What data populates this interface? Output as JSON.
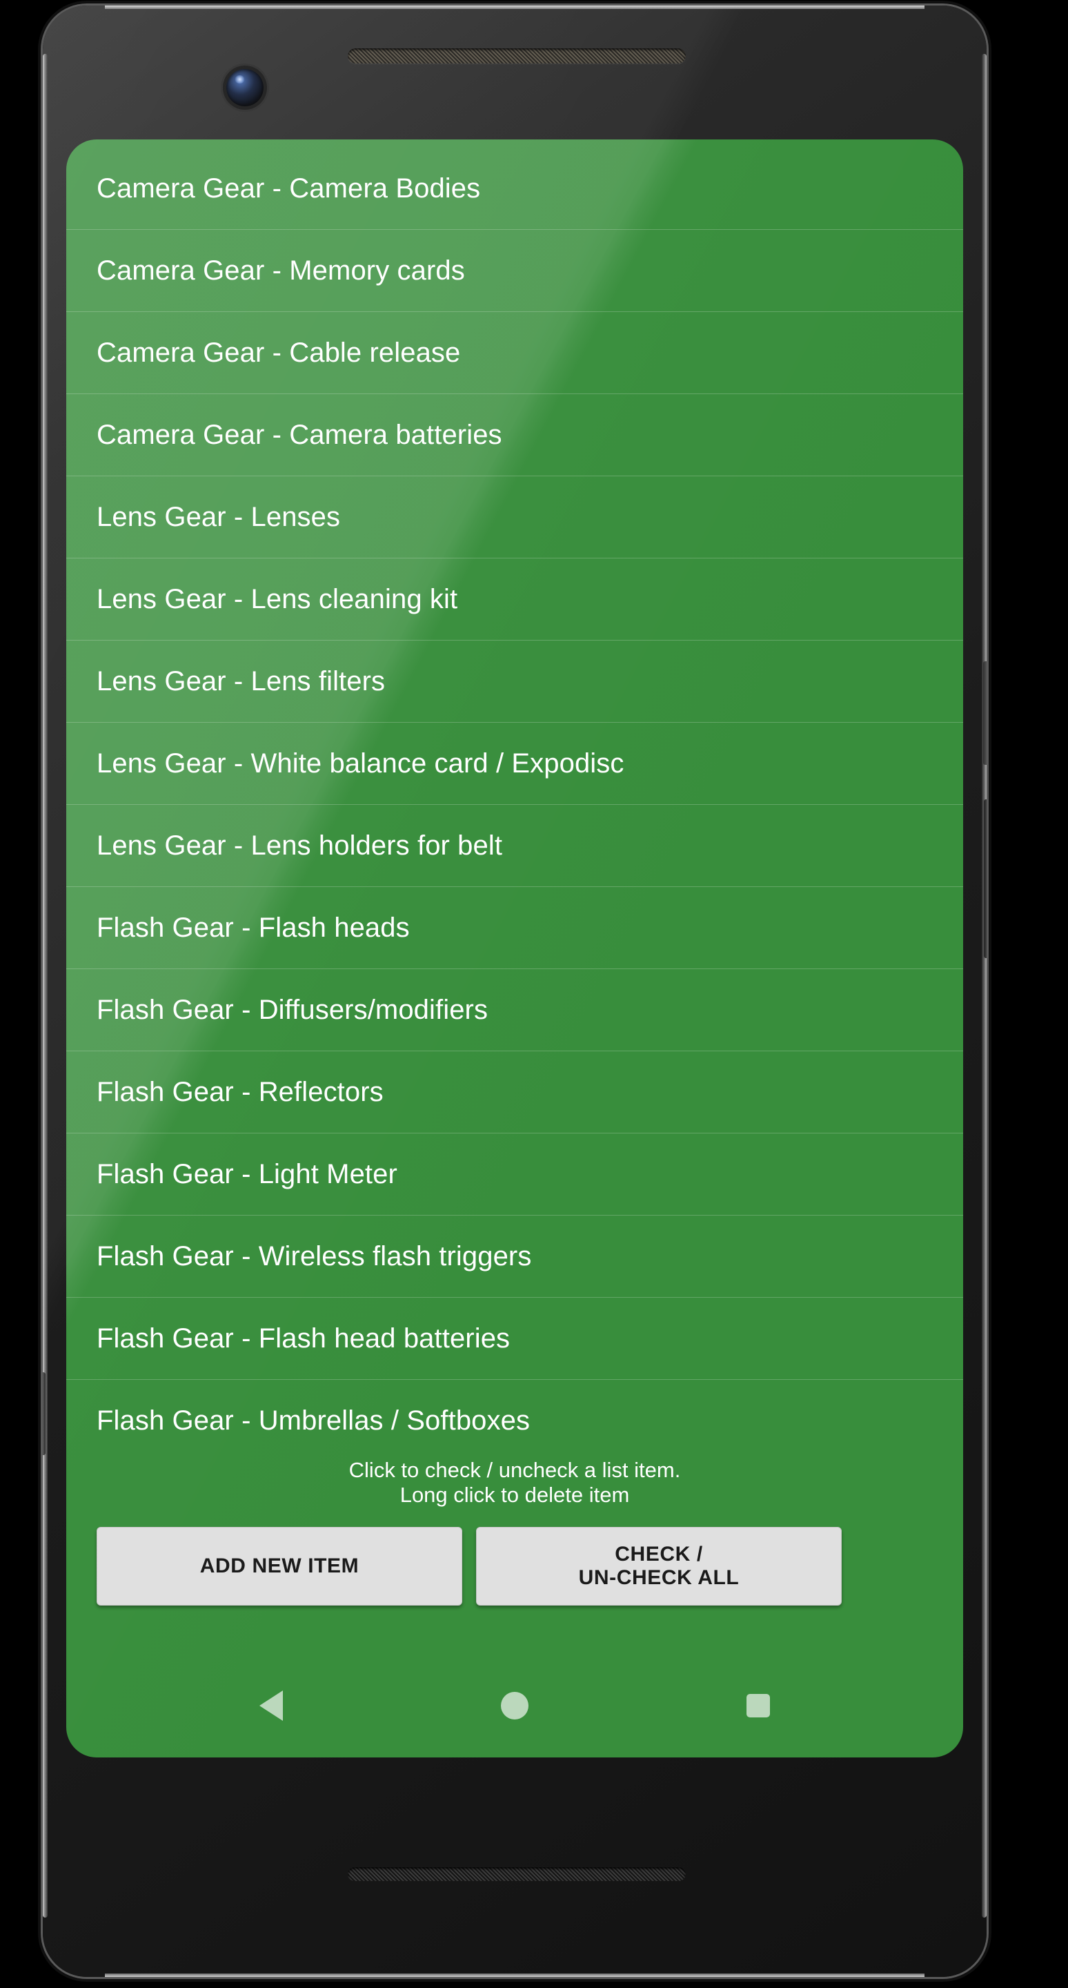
{
  "device": {
    "frame_color": "#1c1c1c",
    "earpiece": "earpiece-speaker",
    "front_camera": "front-camera",
    "bottom_speaker": "bottom-speaker"
  },
  "app": {
    "background_color": "#388E3C",
    "text_color": "#FFFFFF"
  },
  "list": {
    "items": [
      {
        "label": "Camera Gear - Camera Bodies"
      },
      {
        "label": "Camera Gear - Memory cards"
      },
      {
        "label": "Camera Gear - Cable release"
      },
      {
        "label": "Camera Gear - Camera batteries"
      },
      {
        "label": "Lens Gear - Lenses"
      },
      {
        "label": "Lens Gear - Lens cleaning kit"
      },
      {
        "label": "Lens Gear - Lens filters"
      },
      {
        "label": "Lens Gear - White balance card / Expodisc"
      },
      {
        "label": "Lens Gear - Lens holders for belt"
      },
      {
        "label": "Flash Gear - Flash heads"
      },
      {
        "label": "Flash Gear - Diffusers/modifiers"
      },
      {
        "label": "Flash Gear - Reflectors"
      },
      {
        "label": "Flash Gear - Light Meter"
      },
      {
        "label": "Flash Gear - Wireless flash triggers"
      },
      {
        "label": "Flash Gear - Flash head batteries"
      },
      {
        "label": "Flash Gear - Umbrellas / Softboxes"
      }
    ]
  },
  "hints": {
    "line1": "Click to check / uncheck a list item.",
    "line2": "Long click to delete item"
  },
  "buttons": {
    "add_new_item": "ADD NEW ITEM",
    "check_uncheck_all_line1": "CHECK /",
    "check_uncheck_all_line2": "UN-CHECK ALL",
    "button_bg": "#E0E0E0",
    "button_text_color": "#1A1A1A"
  },
  "nav_bar": {
    "back": "back-triangle-icon",
    "home": "home-circle-icon",
    "recents": "recents-square-icon"
  }
}
